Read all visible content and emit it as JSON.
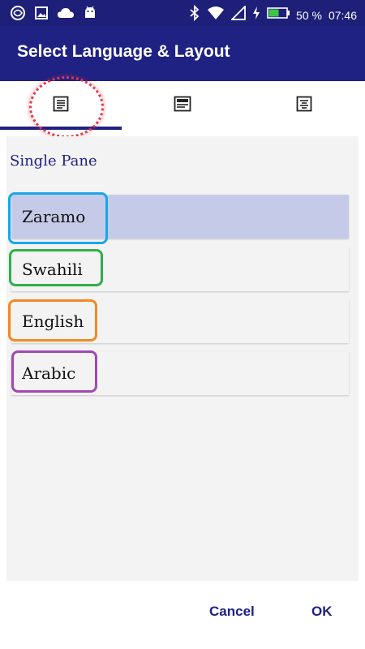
{
  "status_bar": {
    "battery_text": "50 %",
    "time": "07:46",
    "icons": [
      "app-icon",
      "image-icon",
      "cloud-icon",
      "android-icon",
      "bluetooth-icon",
      "wifi-icon",
      "signal-icon",
      "charging-icon",
      "battery-icon"
    ]
  },
  "title": "Select Language & Layout",
  "tabs": [
    {
      "icon": "single-pane-layout-icon",
      "selected": true
    },
    {
      "icon": "two-pane-layout-icon",
      "selected": false
    },
    {
      "icon": "interlinear-layout-icon",
      "selected": false
    }
  ],
  "section": {
    "label": "Single Pane"
  },
  "languages": [
    {
      "label": "Zaramo",
      "selected": true,
      "outline_color": "#1aa6ea"
    },
    {
      "label": "Swahili",
      "selected": false,
      "outline_color": "#2eb04a"
    },
    {
      "label": "English",
      "selected": false,
      "outline_color": "#f28a24"
    },
    {
      "label": "Arabic",
      "selected": false,
      "outline_color": "#a148b6"
    }
  ],
  "buttons": {
    "cancel": "Cancel",
    "ok": "OK"
  },
  "colors": {
    "primary": "#1f2183",
    "selected_row": "#c6cae9",
    "annotation_circle": "#e03a4a"
  }
}
